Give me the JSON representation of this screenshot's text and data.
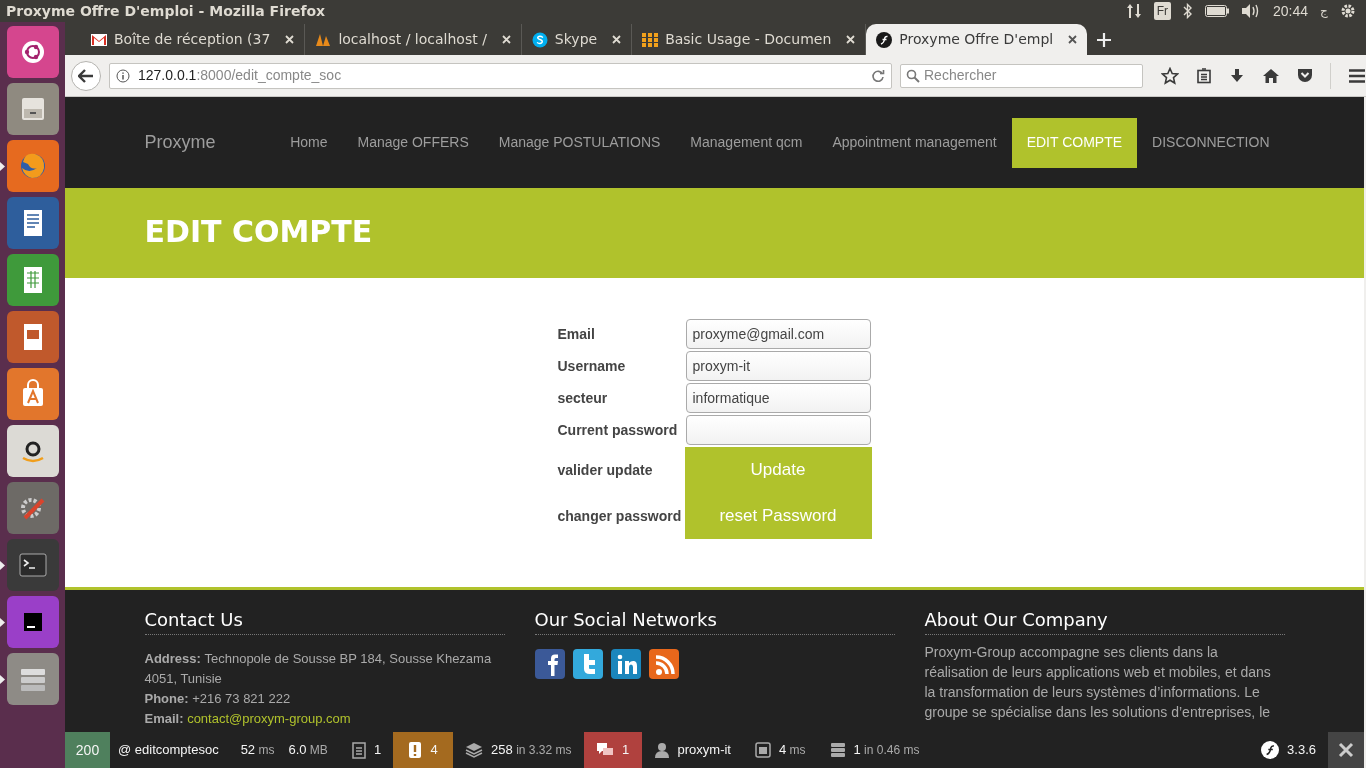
{
  "window": {
    "title": "Proxyme Offre D'emploi - Mozilla Firefox"
  },
  "system_tray": {
    "keyboard": "Fr",
    "time": "20:44",
    "language": "ج"
  },
  "launcher": {
    "items": [
      {
        "kind": "ubuntu",
        "running": false
      },
      {
        "kind": "files",
        "running": false
      },
      {
        "kind": "firefox",
        "running": true
      },
      {
        "kind": "writer",
        "running": false
      },
      {
        "kind": "calc",
        "running": false
      },
      {
        "kind": "impress",
        "running": false
      },
      {
        "kind": "store",
        "running": false
      },
      {
        "kind": "amazon",
        "running": false
      },
      {
        "kind": "settings",
        "running": false
      },
      {
        "kind": "terminal",
        "running": true
      },
      {
        "kind": "phpstorm",
        "running": true
      },
      {
        "kind": "drive",
        "running": true
      }
    ]
  },
  "tabs": [
    {
      "kind": "mail",
      "label": "Boîte de réception (37",
      "selected": false
    },
    {
      "kind": "sail",
      "label": "localhost / localhost / ",
      "selected": false
    },
    {
      "kind": "skype",
      "label": "Skype",
      "selected": false
    },
    {
      "kind": "grid",
      "label": "Basic Usage - Documen",
      "selected": false
    },
    {
      "kind": "symfony",
      "label": "Proxyme Offre D'empl",
      "selected": true
    }
  ],
  "address_bar": {
    "host": "127.0.0.1",
    "path": ":8000/edit_compte_soc"
  },
  "search": {
    "placeholder": "Rechercher"
  },
  "site_nav": {
    "brand": "Proxyme",
    "items": [
      {
        "label": "Home",
        "selected": false
      },
      {
        "label": "Manage OFFERS",
        "selected": false
      },
      {
        "label": "Manage POSTULATIONS",
        "selected": false
      },
      {
        "label": "Management qcm",
        "selected": false
      },
      {
        "label": "Appointment management",
        "selected": false
      },
      {
        "label": "EDIT COMPTE",
        "selected": true
      },
      {
        "label": "DISCONNECTION",
        "selected": false
      }
    ]
  },
  "banner": {
    "title": "EDIT COMPTE"
  },
  "form": {
    "rows": [
      {
        "kind": "input",
        "label": "Email",
        "value": "proxyme@gmail.com"
      },
      {
        "kind": "input",
        "label": "Username",
        "value": "proxym-it"
      },
      {
        "kind": "input",
        "label": "secteur",
        "value": "informatique"
      },
      {
        "kind": "input",
        "label": "Current password",
        "value": ""
      },
      {
        "kind": "button",
        "label": "valider update",
        "button": "Update"
      },
      {
        "kind": "button",
        "label": "changer password",
        "button": "reset Password"
      }
    ]
  },
  "footer": {
    "contact": {
      "title": "Contact Us",
      "lines": [
        {
          "kind": "text",
          "label": "Address:",
          "value": "Technopole de Sousse BP 184, Sousse Khezama 4051, Tunisie"
        },
        {
          "kind": "text",
          "label": "Phone:",
          "value": "+216 73 821 222"
        },
        {
          "kind": "link",
          "label": "Email:",
          "value": "contact@proxym-group.com"
        }
      ]
    },
    "social": {
      "title": "Our Social Networks",
      "icons": [
        {
          "kind": "facebook"
        },
        {
          "kind": "twitter"
        },
        {
          "kind": "linkedin"
        },
        {
          "kind": "rss"
        }
      ]
    },
    "about": {
      "title": "About Our Company",
      "text": "Proxym-Group accompagne ses clients dans la réalisation de leurs applications web et mobiles, et dans la transformation de leurs systèmes d’informations. Le groupe se spécialise dans les solutions d’entreprises, le"
    }
  },
  "debug_toolbar": {
    "items": [
      {
        "kind": "status",
        "value": "200",
        "color": "#4f805d"
      },
      {
        "kind": "route",
        "value": "@ editcomptesoc"
      },
      {
        "kind": "time",
        "value": "52",
        "unit": "ms"
      },
      {
        "kind": "memory",
        "value": "6.0",
        "unit": "MB"
      },
      {
        "kind": "form",
        "value": "1"
      },
      {
        "kind": "logs",
        "value": "4",
        "color": "#a46a1f"
      },
      {
        "kind": "cache",
        "value": "258",
        "unit": "in 3.32 ms"
      },
      {
        "kind": "translation",
        "value": "1",
        "color": "#b0413e"
      },
      {
        "kind": "user",
        "value": "proxym-it"
      },
      {
        "kind": "twig",
        "value": "4",
        "unit": "ms"
      },
      {
        "kind": "db",
        "value": "1",
        "unit": "in 0.46 ms"
      }
    ],
    "version": "3.3.6"
  }
}
